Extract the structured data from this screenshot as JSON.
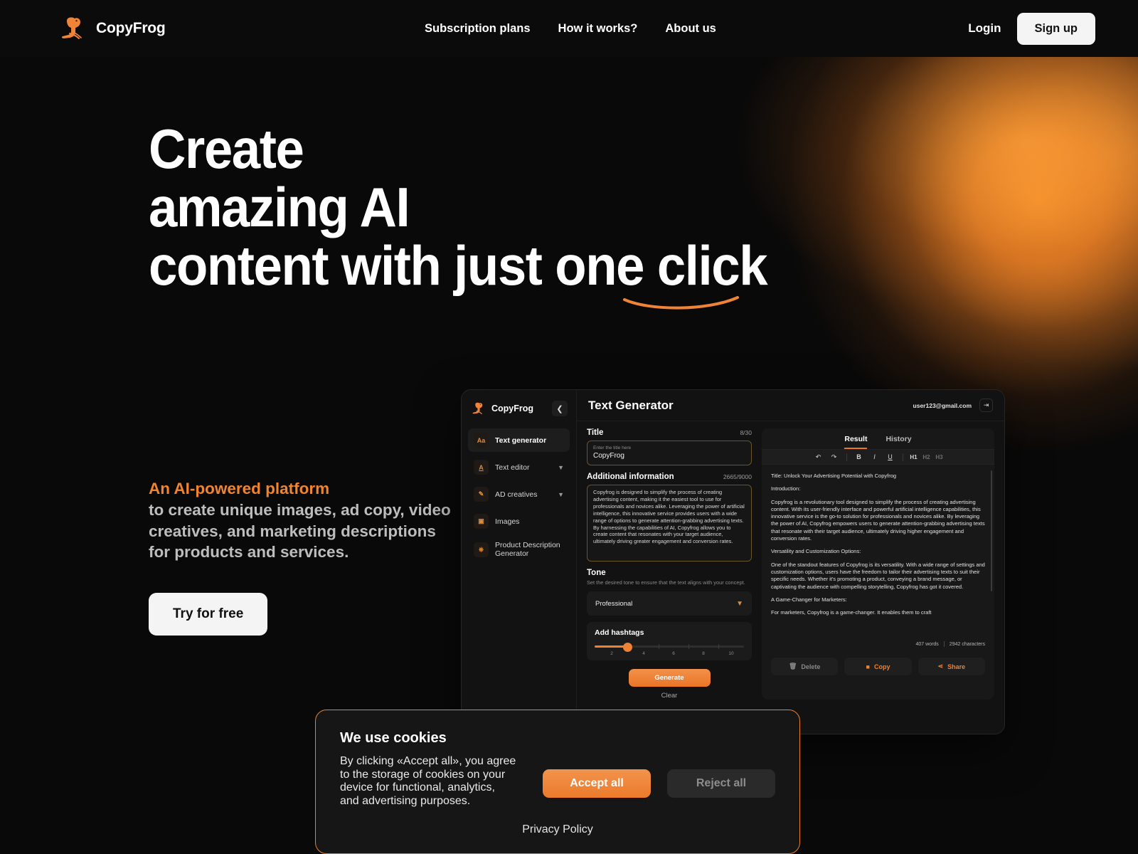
{
  "header": {
    "brand": "CopyFrog",
    "logo_icon": "frog-logo-icon",
    "nav": [
      {
        "label": "Subscription plans"
      },
      {
        "label": "How it works?"
      },
      {
        "label": "About us"
      }
    ],
    "login_label": "Login",
    "signup_label": "Sign up"
  },
  "hero": {
    "line1": "Create",
    "line2": "amazing AI",
    "line3": "content with just one click",
    "accent_text": "An AI-powered platform",
    "body_text": "to create unique images, ad copy, video creatives, and marketing descriptions for products and services.",
    "cta_label": "Try for free"
  },
  "app": {
    "sidebar": {
      "brand": "CopyFrog",
      "collapse_icon": "chevron-left-icon",
      "items": [
        {
          "label": "Text generator",
          "icon": "aa-text-icon",
          "glyph": "Aa",
          "active": true,
          "expandable": false
        },
        {
          "label": "Text editor",
          "icon": "underline-a-icon",
          "glyph": "A",
          "active": false,
          "expandable": true
        },
        {
          "label": "AD creatives",
          "icon": "brush-icon",
          "glyph": "✎",
          "active": false,
          "expandable": true
        },
        {
          "label": "Images",
          "icon": "image-icon",
          "glyph": "Ὓb",
          "active": false,
          "expandable": false
        },
        {
          "label": "Product Description Generator",
          "icon": "basket-icon",
          "glyph": "⌸",
          "active": false,
          "expandable": false
        }
      ]
    },
    "title": "Text Generator",
    "user_email": "user123@gmail.com",
    "logout_icon": "logout-icon",
    "form": {
      "title_label": "Title",
      "title_counter": "8/30",
      "title_placeholder": "Enter the title here",
      "title_value": "CopyFrog",
      "info_label": "Additional information",
      "info_counter": "2665/9000",
      "info_value": "Copyfrog is designed to simplify the process of creating advertising content, making it the easiest tool to use for professionals and novices alike. Leveraging the power of artificial intelligence, this innovative service provides users with a wide range of options to generate attention-grabbing advertising texts. By harnessing the capabilities of AI, Copyfrog allows you to create content that resonates with your target audience, ultimately driving greater engagement and conversion rates.",
      "tone_label": "Tone",
      "tone_desc": "Set the desired tone to ensure that the text aligns with your concept.",
      "tone_value": "Professional",
      "tone_chevron": "chevron-down-icon",
      "hashtags_label": "Add hashtags",
      "hashtags_value": 2,
      "hashtags_ticks": [
        "2",
        "4",
        "6",
        "8",
        "10"
      ],
      "generate_label": "Generate",
      "clear_label": "Clear"
    },
    "result": {
      "tabs": [
        {
          "label": "Result",
          "active": true
        },
        {
          "label": "History",
          "active": false
        }
      ],
      "toolbar": [
        {
          "name": "undo-icon",
          "glyph": "↶"
        },
        {
          "name": "redo-icon",
          "glyph": "↷"
        },
        {
          "name": "bold-icon",
          "glyph": "B"
        },
        {
          "name": "italic-icon",
          "glyph": "I"
        },
        {
          "name": "underline-icon",
          "glyph": "U"
        },
        {
          "name": "heading-1-icon",
          "glyph": "H1"
        },
        {
          "name": "heading-2-icon",
          "glyph": "H2"
        },
        {
          "name": "heading-3-icon",
          "glyph": "H3"
        }
      ],
      "paragraphs": [
        "Title: Unlock Your Advertising Potential with Copyfrog",
        "Introduction:",
        "Copyfrog is a revolutionary tool designed to simplify the process of creating advertising content. With its user-friendly interface and powerful artificial intelligence capabilities, this innovative service is the go-to solution for professionals and novices alike. By leveraging the power of AI, Copyfrog empowers users to generate attention-grabbing advertising texts that resonate with their target audience, ultimately driving higher engagement and conversion rates.",
        "Versatility and Customization Options:",
        "One of the standout features of Copyfrog is its versatility. With a wide range of settings and customization options, users have the freedom to tailor their advertising texts to suit their specific needs. Whether it's promoting a product, conveying a brand message, or captivating the audience with compelling storytelling, Copyfrog has got it covered.",
        "A Game-Changer for Marketers:",
        "For marketers, Copyfrog is a game-changer. It enables them to craft"
      ],
      "word_count": "407 words",
      "char_count": "2942 characters",
      "actions": [
        {
          "label": "Delete",
          "icon": "trash-icon",
          "glyph": "🗑"
        },
        {
          "label": "Copy",
          "icon": "copy-icon",
          "glyph": "❐"
        },
        {
          "label": "Share",
          "icon": "share-icon",
          "glyph": "❦"
        }
      ]
    }
  },
  "cookie": {
    "title": "We use cookies",
    "text": "By clicking «Accept all», you agree to the storage of cookies on your device for functional, analytics, and advertising purposes.",
    "accept_label": "Accept all",
    "reject_label": "Reject all",
    "privacy_label": "Privacy Policy"
  },
  "colors": {
    "accent": "#ee8133",
    "background": "#090909",
    "panel": "#121212"
  }
}
